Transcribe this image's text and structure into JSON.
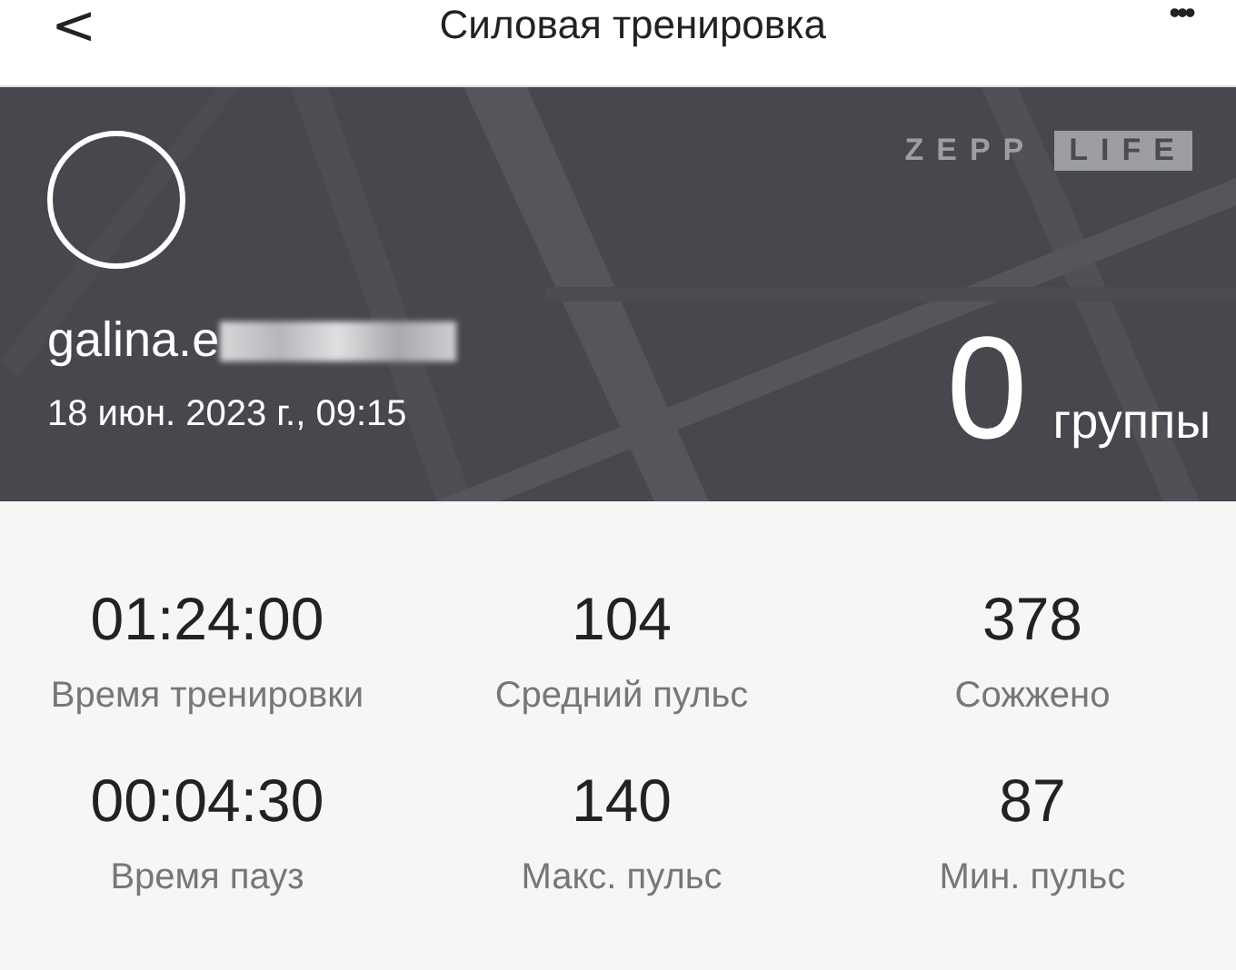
{
  "header": {
    "back": "<",
    "title": "Силовая тренировка",
    "menu": "•••"
  },
  "summary": {
    "logo": [
      "ZEPP",
      "LIFE"
    ],
    "user": "galina.e",
    "date": "18 июн. 2023 г., 09:15",
    "count": "0",
    "unit": "группы"
  },
  "stats": [
    {
      "value": "01:24:00",
      "label": "Время тренировки"
    },
    {
      "value": "104",
      "label": "Средний пульс"
    },
    {
      "value": "378",
      "label": "Сожжено"
    },
    {
      "value": "00:04:30",
      "label": "Время пауз"
    },
    {
      "value": "140",
      "label": "Макс. пульс"
    },
    {
      "value": "87",
      "label": "Мин. пульс"
    }
  ]
}
